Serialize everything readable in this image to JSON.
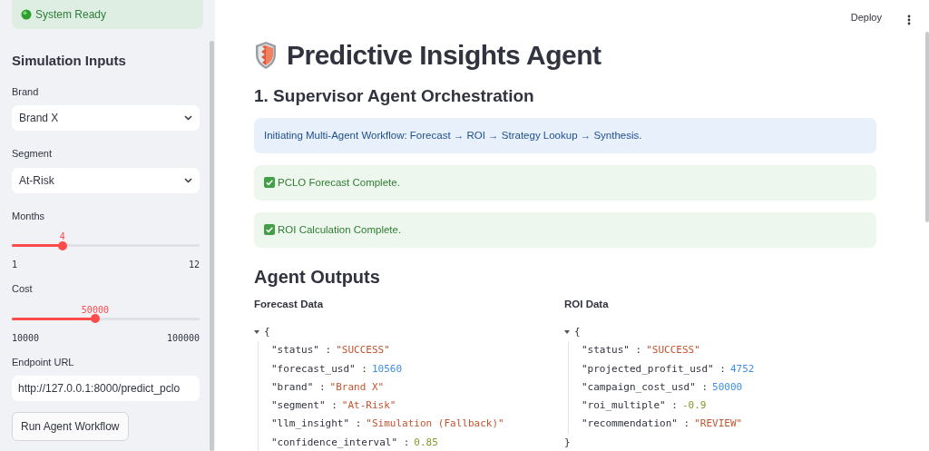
{
  "sidebar": {
    "status": {
      "text": "System Ready"
    },
    "heading": "Simulation Inputs",
    "inputs": [
      {
        "kind": "select",
        "label": "Brand",
        "value": "Brand X"
      },
      {
        "kind": "select",
        "label": "Segment",
        "value": "At-Risk"
      },
      {
        "kind": "slider",
        "label": "Months",
        "value": "4",
        "min": "1",
        "max": "12",
        "level": 0.27
      },
      {
        "kind": "slider",
        "label": "Cost",
        "value": "50000",
        "min": "10000",
        "max": "100000",
        "level": 0.444
      },
      {
        "kind": "text",
        "label": "Endpoint URL",
        "value": "http://127.0.0.1:8000/predict_pclo"
      }
    ],
    "button": "Run Agent Workflow"
  },
  "toolbar": {
    "deploy": "Deploy"
  },
  "main": {
    "title": "Predictive Insights Agent",
    "section": "1. Supervisor Agent Orchestration",
    "alerts": [
      {
        "kind": "info",
        "text": "Initiating Multi-Agent Workflow: Forecast → ROI → Strategy Lookup → Synthesis."
      },
      {
        "kind": "success",
        "text": "PCLO Forecast Complete."
      },
      {
        "kind": "success",
        "text": "ROI Calculation Complete."
      }
    ],
    "outputs_heading": "Agent Outputs",
    "panels": [
      {
        "title": "Forecast Data",
        "open": "{",
        "entries": [
          {
            "key": "\"status\" :",
            "value": "\"SUCCESS\"",
            "kind": "string"
          },
          {
            "key": "\"forecast_usd\" :",
            "value": "10560",
            "kind": "int"
          },
          {
            "key": "\"brand\" :",
            "value": "\"Brand X\"",
            "kind": "string"
          },
          {
            "key": "\"segment\" :",
            "value": "\"At-Risk\"",
            "kind": "string"
          },
          {
            "key": "\"llm_insight\" :",
            "value": "\"Simulation (Fallback)\"",
            "kind": "string"
          },
          {
            "key": "\"confidence_interval\" :",
            "value": "0.85",
            "kind": "float"
          }
        ]
      },
      {
        "title": "ROI Data",
        "open": "{",
        "close": "}",
        "entries": [
          {
            "key": "\"status\" :",
            "value": "\"SUCCESS\"",
            "kind": "string"
          },
          {
            "key": "\"projected_profit_usd\" :",
            "value": "4752",
            "kind": "int"
          },
          {
            "key": "\"campaign_cost_usd\" :",
            "value": "50000",
            "kind": "int"
          },
          {
            "key": "\"roi_multiple\" :",
            "value": "-0.9",
            "kind": "float"
          },
          {
            "key": "\"recommendation\" :",
            "value": "\"REVIEW\"",
            "kind": "string"
          }
        ]
      }
    ]
  }
}
